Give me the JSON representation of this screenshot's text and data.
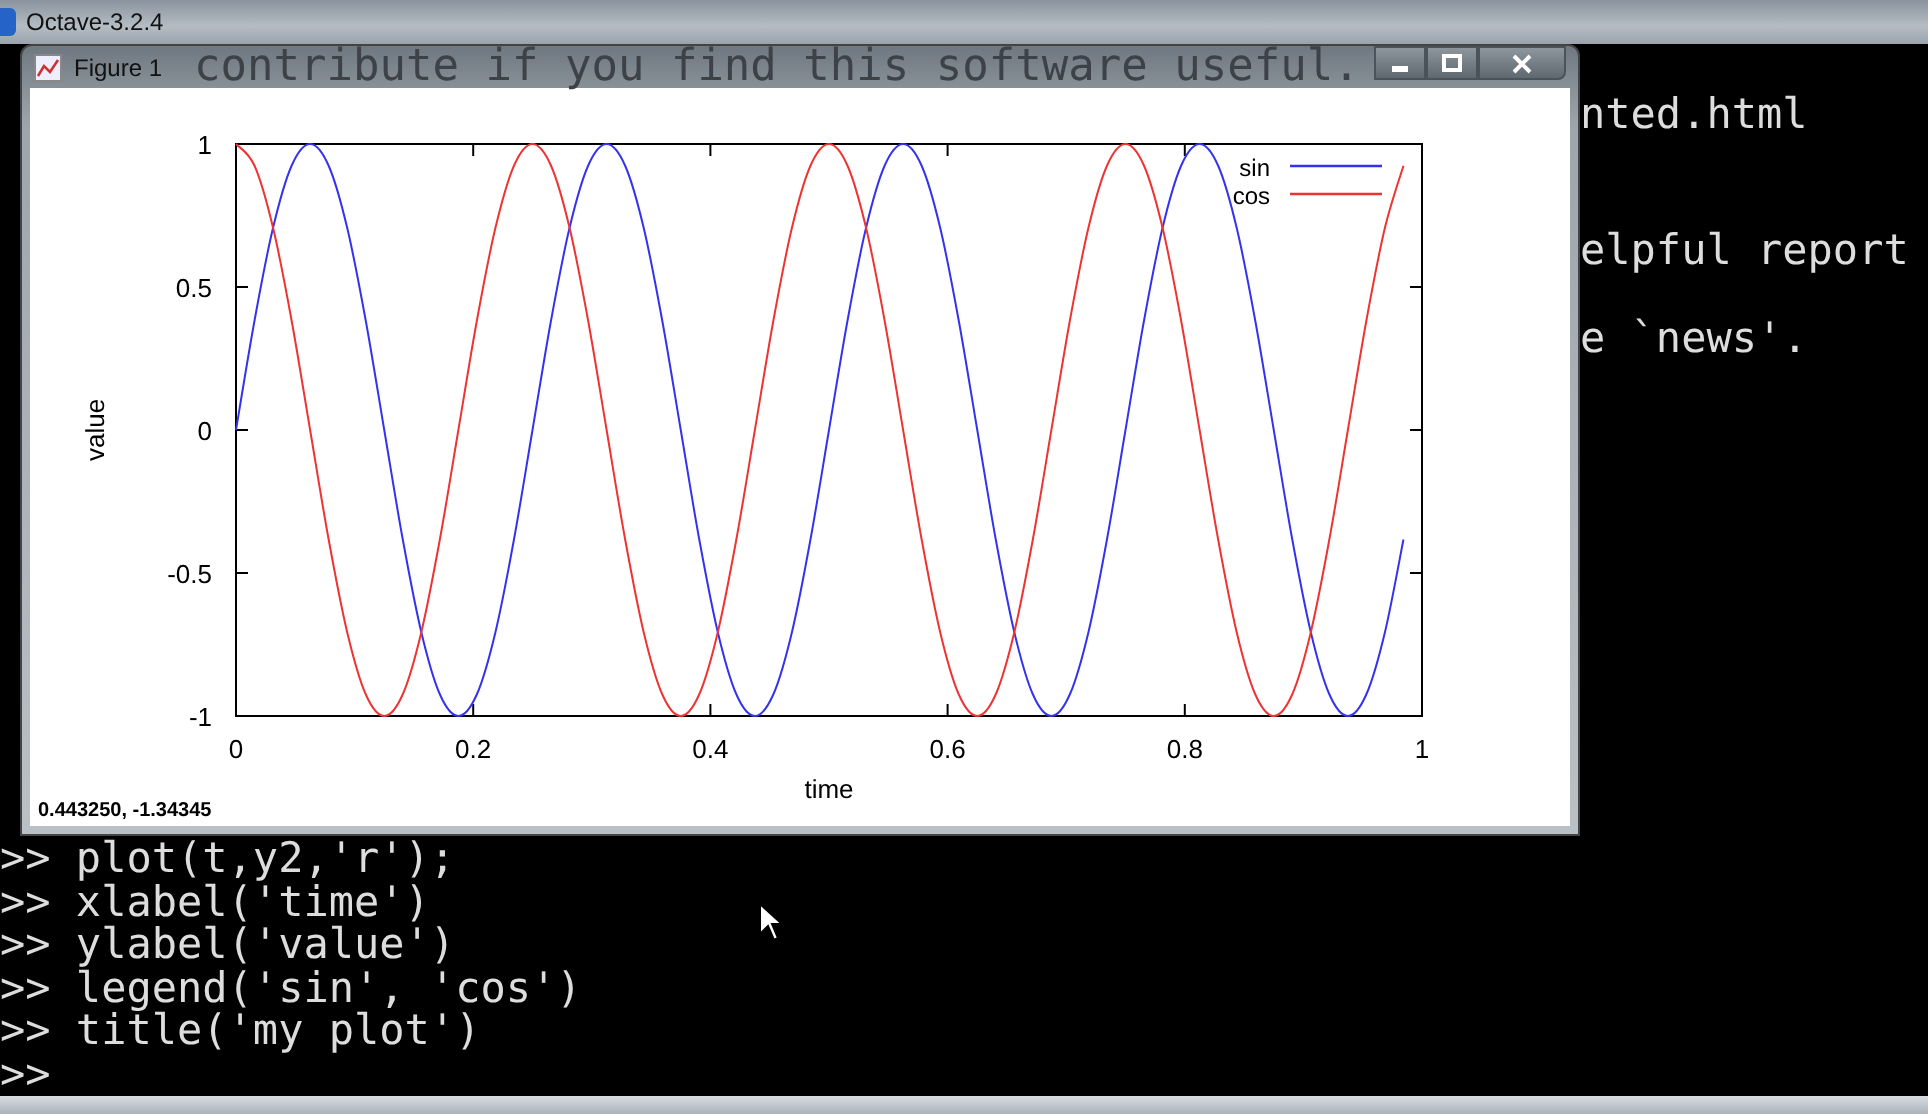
{
  "octave_window": {
    "title": "Octave-3.2.4"
  },
  "terminal": {
    "hidden_line": "contribute if you find this software useful.",
    "right_fragments": [
      "nted.html",
      "elpful report",
      "e `news'."
    ],
    "command_lines": [
      {
        "prompt": ">>",
        "command": "plot(t,y2,'r');"
      },
      {
        "prompt": ">>",
        "command": "xlabel('time')"
      },
      {
        "prompt": ">>",
        "command": "ylabel('value')"
      },
      {
        "prompt": ">>",
        "command": "legend('sin', 'cos')"
      },
      {
        "prompt": ">>",
        "command": "title('my plot')"
      },
      {
        "prompt": ">>"
      }
    ]
  },
  "figure_window": {
    "title": "Figure 1",
    "status": "0.443250, -1.34345",
    "chart_data": {
      "type": "line",
      "xlabel": "time",
      "ylabel": "value",
      "x": [
        0,
        0.015625,
        0.03125,
        0.046875,
        0.0625,
        0.078125,
        0.09375,
        0.109375,
        0.125,
        0.140625,
        0.15625,
        0.171875,
        0.1875,
        0.203125,
        0.21875,
        0.234375,
        0.25,
        0.265625,
        0.28125,
        0.296875,
        0.3125,
        0.328125,
        0.34375,
        0.359375,
        0.375,
        0.390625,
        0.40625,
        0.421875,
        0.4375,
        0.453125,
        0.46875,
        0.484375,
        0.5,
        0.515625,
        0.53125,
        0.546875,
        0.5625,
        0.578125,
        0.59375,
        0.609375,
        0.625,
        0.640625,
        0.65625,
        0.671875,
        0.6875,
        0.703125,
        0.71875,
        0.734375,
        0.75,
        0.765625,
        0.78125,
        0.796875,
        0.8125,
        0.828125,
        0.84375,
        0.859375,
        0.875,
        0.890625,
        0.90625,
        0.921875,
        0.9375,
        0.953125,
        0.96875,
        0.984375
      ],
      "series": [
        {
          "name": "sin",
          "color": "#3333ee",
          "values": [
            0,
            0.383,
            0.707,
            0.924,
            1,
            0.924,
            0.707,
            0.383,
            0,
            -0.383,
            -0.707,
            -0.924,
            -1,
            -0.924,
            -0.707,
            -0.383,
            0,
            0.383,
            0.707,
            0.924,
            1,
            0.924,
            0.707,
            0.383,
            0,
            -0.383,
            -0.707,
            -0.924,
            -1,
            -0.924,
            -0.707,
            -0.383,
            0,
            0.383,
            0.707,
            0.924,
            1,
            0.924,
            0.707,
            0.383,
            0,
            -0.383,
            -0.707,
            -0.924,
            -1,
            -0.924,
            -0.707,
            -0.383,
            0,
            0.383,
            0.707,
            0.924,
            1,
            0.924,
            0.707,
            0.383,
            0,
            -0.383,
            -0.707,
            -0.924,
            -1,
            -0.924,
            -0.707,
            -0.383
          ]
        },
        {
          "name": "cos",
          "color": "#ee3333",
          "values": [
            1,
            0.924,
            0.707,
            0.383,
            0,
            -0.383,
            -0.707,
            -0.924,
            -1,
            -0.924,
            -0.707,
            -0.383,
            0,
            0.383,
            0.707,
            0.924,
            1,
            0.924,
            0.707,
            0.383,
            0,
            -0.383,
            -0.707,
            -0.924,
            -1,
            -0.924,
            -0.707,
            -0.383,
            0,
            0.383,
            0.707,
            0.924,
            1,
            0.924,
            0.707,
            0.383,
            0,
            -0.383,
            -0.707,
            -0.924,
            -1,
            -0.924,
            -0.707,
            -0.383,
            0,
            0.383,
            0.707,
            0.924,
            1,
            0.924,
            0.707,
            0.383,
            0,
            -0.383,
            -0.707,
            -0.924,
            -1,
            -0.924,
            -0.707,
            -0.383,
            0,
            0.383,
            0.707,
            0.924
          ]
        }
      ],
      "legend": true,
      "xlim": [
        0,
        1
      ],
      "ylim": [
        -1,
        1
      ],
      "xticks": [
        0,
        0.2,
        0.4,
        0.6,
        0.8,
        1
      ],
      "yticks": [
        -1,
        -0.5,
        0,
        0.5,
        1
      ]
    }
  }
}
